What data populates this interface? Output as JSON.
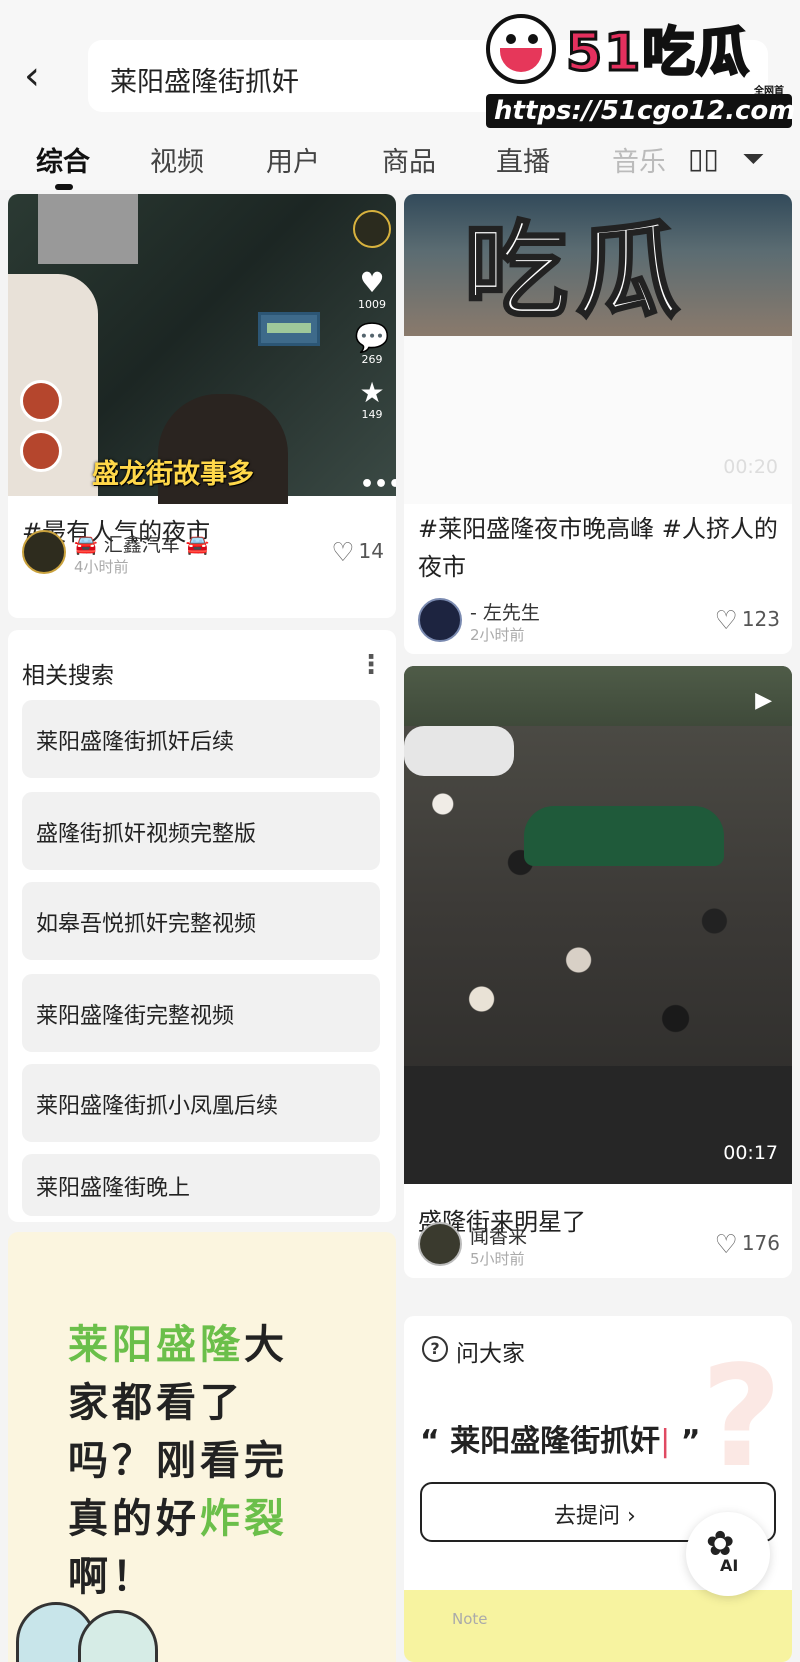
{
  "search": {
    "query": "莱阳盛隆街抓奸"
  },
  "watermark": {
    "brand": "51吃瓜",
    "sub": "全网首发",
    "url": "https://51cgo12.com"
  },
  "tabs": [
    {
      "label": "综合"
    },
    {
      "label": "视频"
    },
    {
      "label": "用户"
    },
    {
      "label": "商品"
    },
    {
      "label": "直播"
    },
    {
      "label": "音乐"
    }
  ],
  "feed": {
    "post1": {
      "caption": "盛龙街故事多",
      "side_counts": {
        "likes": "1009",
        "comments": "269",
        "favorites": "149"
      },
      "title": "#最有人气的夜市",
      "author": "🚘 汇鑫汽车 🚘",
      "time": "4小时前",
      "likes": "14"
    },
    "post2": {
      "overlay": "吃瓜",
      "duration": "00:20",
      "title": "#莱阳盛隆夜市晚高峰 #人挤人的夜市",
      "author": "- 左先生",
      "time": "2小时前",
      "likes": "123"
    },
    "post3": {
      "duration": "00:17",
      "title": "盛隆街来明星了",
      "author": "闻香来",
      "time": "5小时前",
      "likes": "176"
    }
  },
  "related": {
    "title": "相关搜索",
    "items": [
      "莱阳盛隆街抓奸后续",
      "盛隆街抓奸视频完整版",
      "如皋吾悦抓奸完整视频",
      "莱阳盛隆街完整视频",
      "莱阳盛隆街抓小凤凰后续",
      "莱阳盛隆街晚上"
    ]
  },
  "poster": {
    "line1_green": "莱阳盛隆",
    "line1_rest": "大",
    "line2": "家都看了",
    "line3": "吗？刚看完",
    "line4_black": "真的好",
    "line4_green": "炸裂",
    "line5": "啊！"
  },
  "ask": {
    "label": "问大家",
    "quote_open": "“",
    "quote_text": "莱阳盛隆街抓奸",
    "quote_close": "”",
    "button": "去提问 ›"
  },
  "note_label": "Note",
  "ai_label": "AI",
  "colors": {
    "accent_red": "#e04a62",
    "green": "#6bbf4a",
    "brand": "#e5305e"
  }
}
